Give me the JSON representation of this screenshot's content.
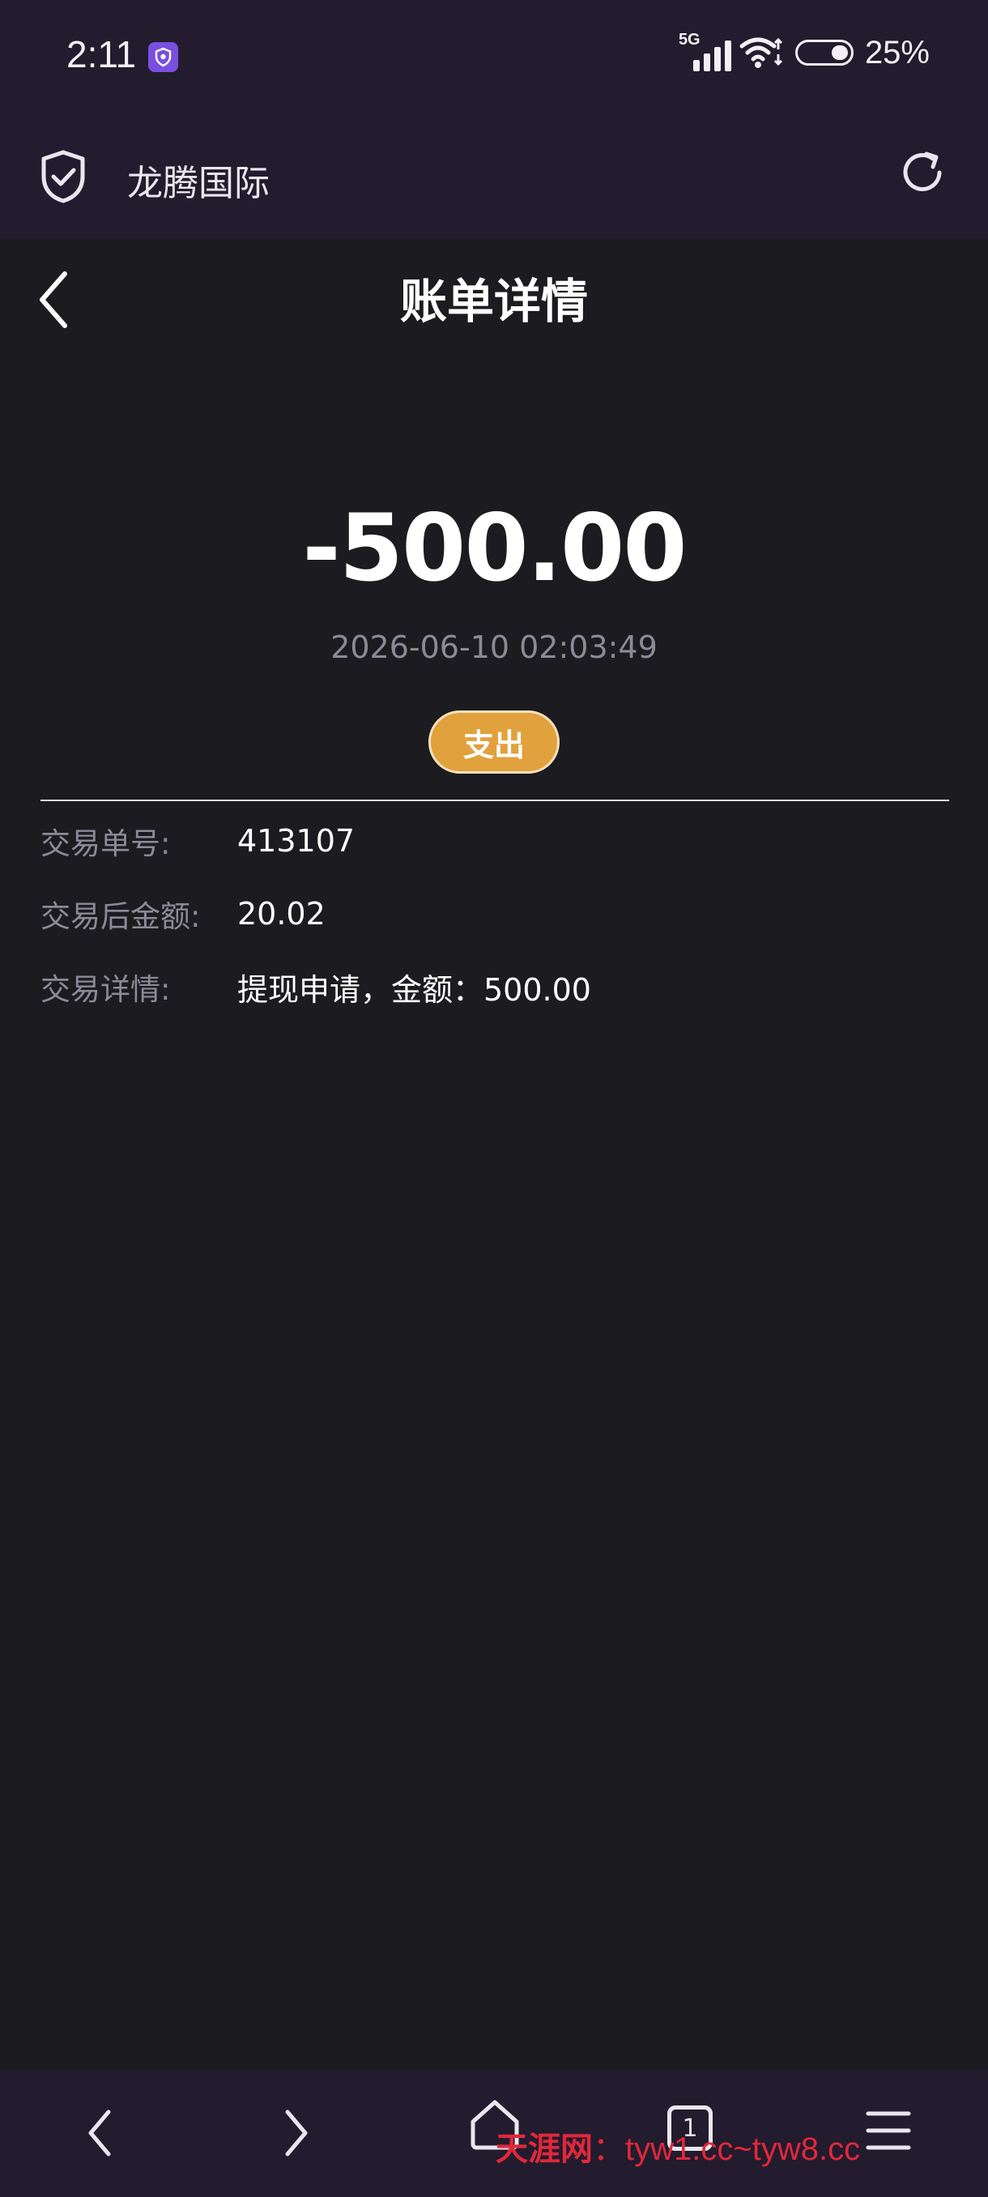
{
  "status_bar": {
    "time": "2:11",
    "network": "5G",
    "battery": "25%",
    "icons": [
      "app-shield-icon",
      "signal-icon",
      "wifi-icon",
      "battery-icon"
    ]
  },
  "browser": {
    "site_title": "龙腾国际",
    "icons": [
      "shield-check-icon",
      "refresh-icon"
    ]
  },
  "page": {
    "title": "账单详情",
    "amount": "-500.00",
    "datetime": "2026-06-10 02:03:49",
    "type": "支出"
  },
  "details": [
    {
      "label": "交易单号:",
      "value": "413107"
    },
    {
      "label": "交易后金额:",
      "value": "20.02"
    },
    {
      "label": "交易详情:",
      "value": "提现申请，金额：500.00"
    }
  ],
  "nav": {
    "tab_count": "1",
    "icons": [
      "back-icon",
      "forward-icon",
      "home-icon",
      "tabs-icon",
      "menu-icon"
    ]
  },
  "watermark": {
    "brand": "天涯网",
    "sep": "：",
    "text": "tyw1.cc~tyw8.cc"
  },
  "colors": {
    "accent": "#e1a13c",
    "background": "#1c1b1f",
    "bar": "#231b2e",
    "muted": "#8c8a98"
  }
}
